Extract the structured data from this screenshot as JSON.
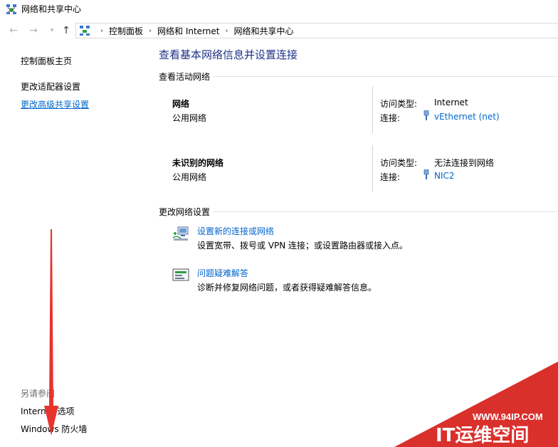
{
  "window": {
    "title": "网络和共享中心"
  },
  "breadcrumb": [
    "控制面板",
    "网络和 Internet",
    "网络和共享中心"
  ],
  "sidebar": {
    "links": [
      "控制面板主页",
      "更改适配器设置",
      "更改高级共享设置"
    ],
    "see_also_heading": "另请参阅",
    "see_also": [
      "Internet 选项",
      "Windows 防火墙"
    ]
  },
  "main": {
    "title": "查看基本网络信息并设置连接",
    "active_networks_heading": "查看活动网络",
    "networks": [
      {
        "name": "网络",
        "type": "公用网络",
        "access_label": "访问类型:",
        "access_value": "Internet",
        "conn_label": "连接:",
        "conn_value": "vEthernet (net)"
      },
      {
        "name": "未识别的网络",
        "type": "公用网络",
        "access_label": "访问类型:",
        "access_value": "无法连接到网络",
        "conn_label": "连接:",
        "conn_value": "NIC2"
      }
    ],
    "change_settings_heading": "更改网络设置",
    "tasks": [
      {
        "title": "设置新的连接或网络",
        "desc": "设置宽带、拨号或 VPN 连接；或设置路由器或接入点。"
      },
      {
        "title": "问题疑难解答",
        "desc": "诊断并修复网络问题，或者获得疑难解答信息。"
      }
    ]
  },
  "watermark": {
    "url": "WWW.94IP.COM",
    "name": "IT运维空间"
  },
  "colors": {
    "link": "#0066cc",
    "title": "#1e3287",
    "annotation": "#e8322d",
    "watermark": "#d9302c"
  },
  "icons": [
    "network-center-icon",
    "back-arrow-icon",
    "forward-arrow-icon",
    "up-arrow-icon",
    "control-panel-icon",
    "plug-icon",
    "new-connection-icon",
    "troubleshoot-icon"
  ]
}
